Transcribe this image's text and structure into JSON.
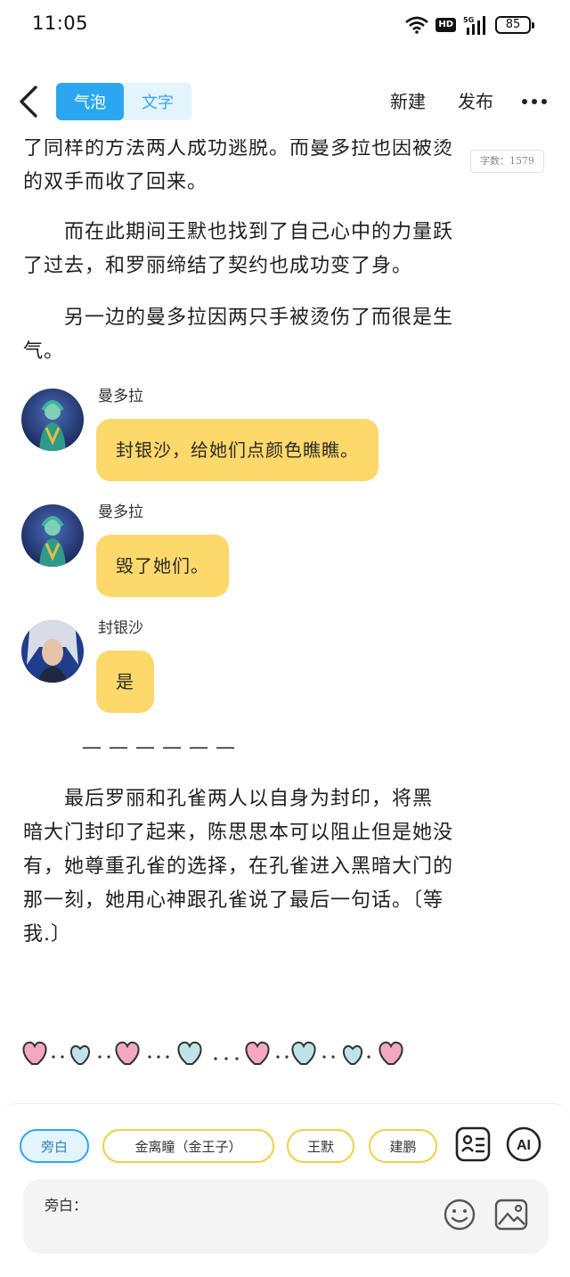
{
  "status_bar": {
    "time": "11:05",
    "network": "5G",
    "hd": "HD",
    "battery": "85"
  },
  "nav": {
    "modes": [
      {
        "label": "气泡",
        "active": true
      },
      {
        "label": "文字",
        "active": false
      }
    ],
    "new_label": "新建",
    "publish_label": "发布"
  },
  "content": {
    "word_count": "字数：1579",
    "para1_line1": "了同样的方法两人成功逃脱。而曼多拉也因被烫",
    "para1_line2": "的双手而收了回来。",
    "para2_line1": "　　而在此期间王默也找到了自己心中的力量跃",
    "para2_line2": "了过去，和罗丽缔结了契约也成功变了身。",
    "para3_line1": "　　另一边的曼多拉因两只手被烫伤了而很是生",
    "para3_line2": "气。",
    "messages": [
      {
        "speaker": "曼多拉",
        "text": "封银沙，给她们点颜色瞧瞧。"
      },
      {
        "speaker": "曼多拉",
        "text": "毁了她们。"
      },
      {
        "speaker": "封银沙",
        "text": "是"
      }
    ],
    "divider": "——————",
    "para4_line1": "　　最后罗丽和孔雀两人以自身为封印，将黑",
    "para4_line2": "暗大门封印了起来，陈思思本可以阻止但是她没",
    "para4_line3": "有，她尊重孔雀的选择，在孔雀进入黑暗大门的",
    "para4_line4": "那一刻，她用心神跟孔雀说了最后一句话。〔等",
    "para4_line5": "我.〕"
  },
  "role_chips": [
    {
      "label": "旁白",
      "selected": true
    },
    {
      "label": "金离瞳（金王子）",
      "selected": false
    },
    {
      "label": "王默",
      "selected": false
    },
    {
      "label": "建鹏",
      "selected": false
    }
  ],
  "icons": {
    "roles": "role-card-icon",
    "ai": "AI",
    "emoji": "smiley-icon",
    "image": "image-icon"
  },
  "input": {
    "label": "旁白："
  },
  "colors": {
    "accent": "#2aa7f0",
    "bubble": "#fdd86a",
    "chip_border": "#f2cf43"
  }
}
